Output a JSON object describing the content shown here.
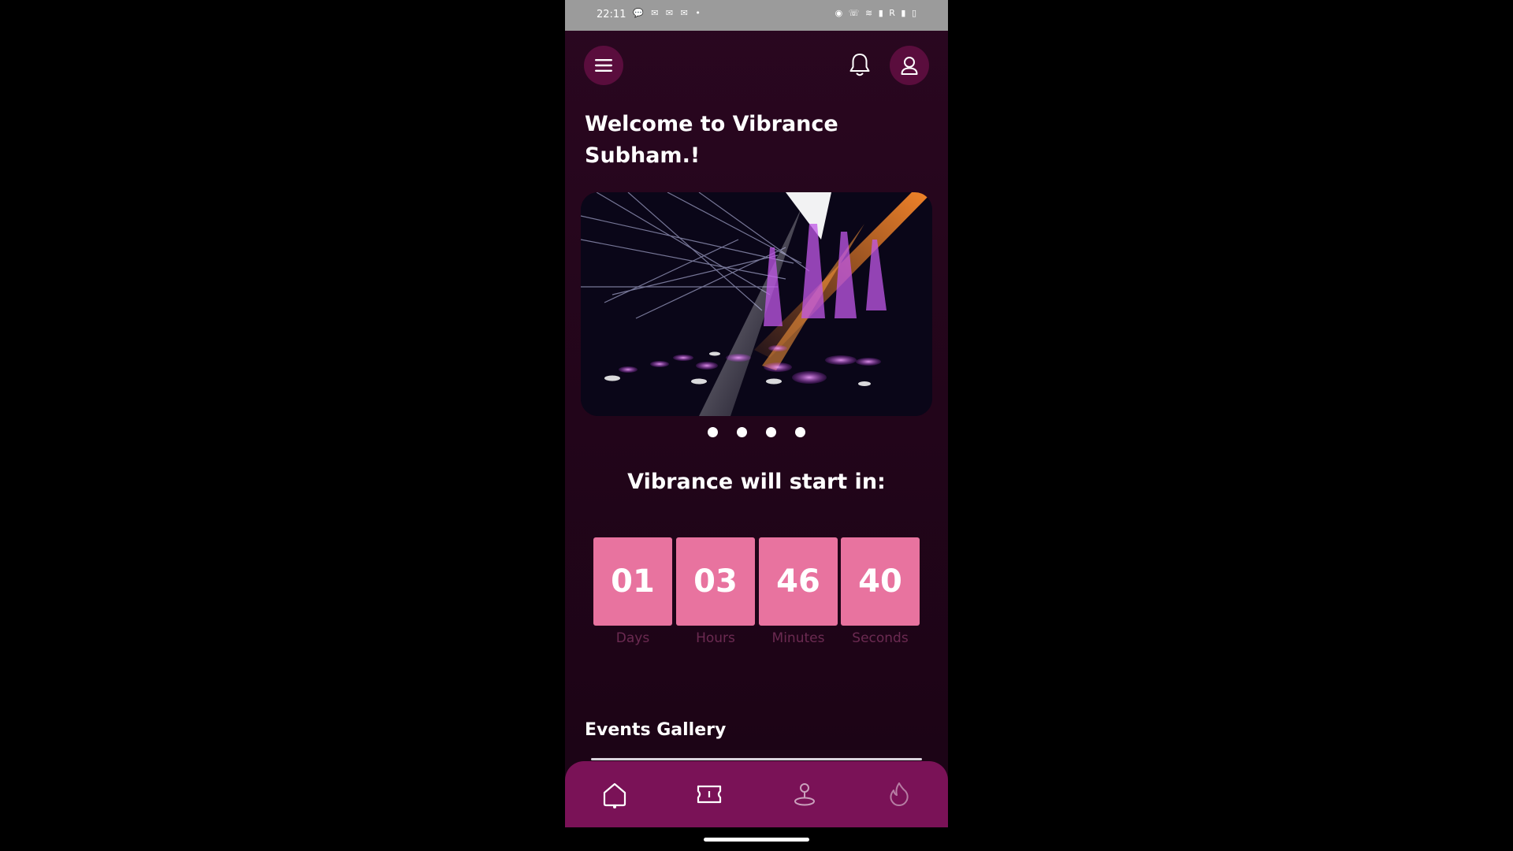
{
  "status_bar": {
    "time": "22:11",
    "left_icons": "💬 ✉ ✉ ✉ •",
    "right_icons": "◉ ☏ ≋ ▮ R ▮ ▯"
  },
  "header": {
    "menu_icon": "hamburger-icon",
    "bell_icon": "bell-icon",
    "profile_icon": "user-icon"
  },
  "welcome": {
    "line1": "Welcome to Vibrance",
    "line2": "Subham.!"
  },
  "carousel": {
    "slides": 4,
    "active_index": 0
  },
  "countdown": {
    "title": "Vibrance will start in:",
    "units": [
      {
        "value": "01",
        "label": "Days"
      },
      {
        "value": "03",
        "label": "Hours"
      },
      {
        "value": "46",
        "label": "Minutes"
      },
      {
        "value": "40",
        "label": "Seconds"
      }
    ]
  },
  "gallery": {
    "title": "Events Gallery"
  },
  "bottom_nav": {
    "items": [
      "home-icon",
      "ticket-icon",
      "location-icon",
      "fire-icon"
    ],
    "active": "home-icon"
  },
  "colors": {
    "background": "#22051a",
    "accent": "#e8739f",
    "nav": "#7a1257",
    "button": "#5a0d3d"
  }
}
